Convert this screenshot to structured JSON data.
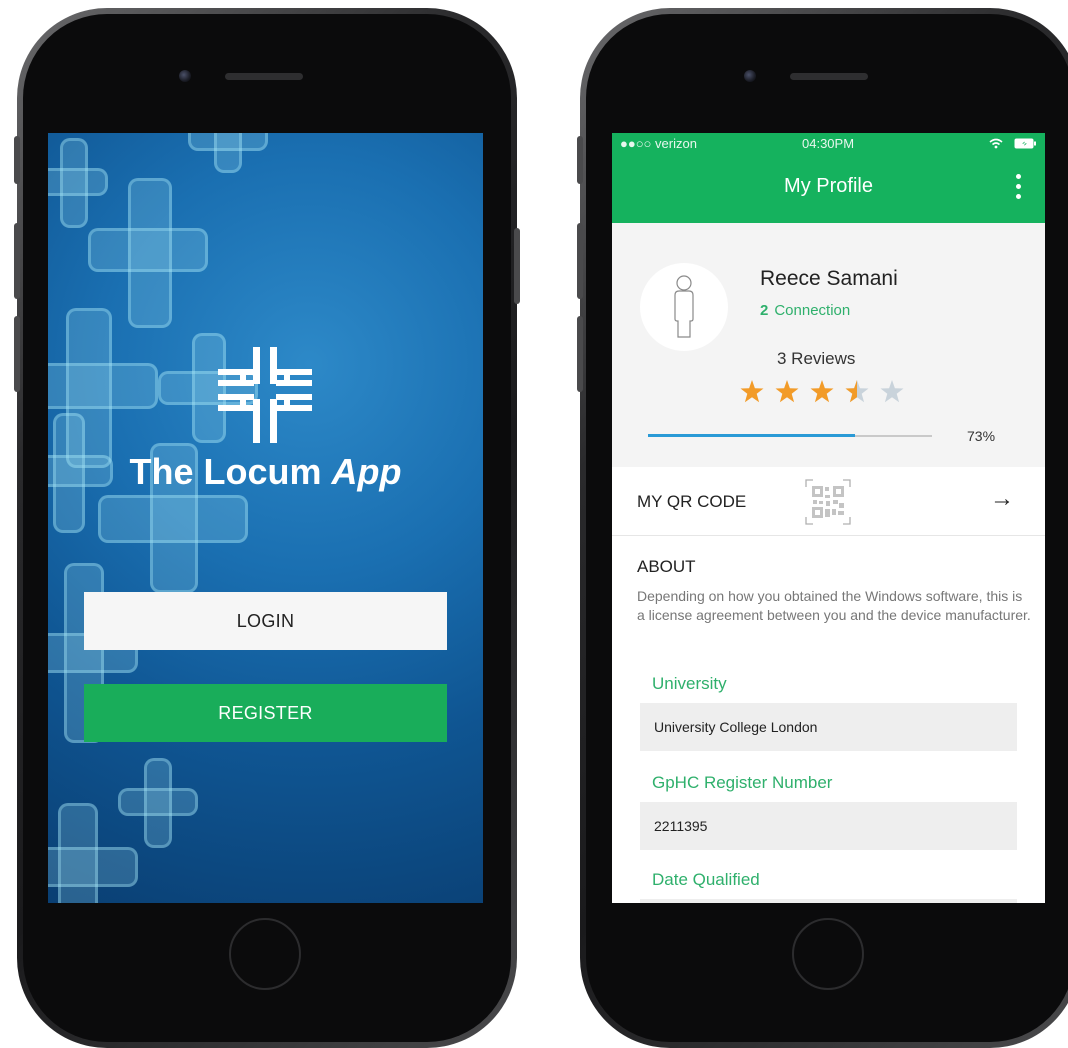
{
  "login_screen": {
    "app_title_plain": "The Locum ",
    "app_title_italic": "App",
    "login_label": "LOGIN",
    "register_label": "REGISTER"
  },
  "profile_screen": {
    "status_bar": {
      "carrier": "●●○○ verizon",
      "time": "04:30PM"
    },
    "title": "My Profile",
    "user": {
      "name": "Reece Samani",
      "connection_count": "2",
      "connection_label": "Connection",
      "reviews": "3 Reviews",
      "rating": 3.5,
      "rating_max": 5,
      "profile_completion": 0.73,
      "profile_completion_label": "73%"
    },
    "qr_label": "MY QR CODE",
    "about_title": "ABOUT",
    "about_text": "Depending on how you obtained the Windows software, this is a license agreement between you and the device manufacturer.",
    "fields": [
      {
        "label": "University",
        "value": "University College London"
      },
      {
        "label": "GpHC Register Number",
        "value": "2211395"
      },
      {
        "label": "Date Qualified",
        "value": ""
      }
    ],
    "colors": {
      "accent": "#15b25e",
      "star": "#f29b28",
      "progress": "#2a9ad6"
    }
  }
}
